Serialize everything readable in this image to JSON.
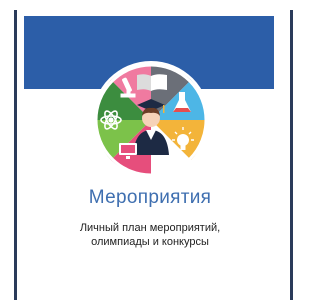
{
  "card": {
    "title": "Мероприятия",
    "subtitle_line1": "Личный план мероприятий,",
    "subtitle_line2": "олимпиады и конкурсы",
    "banner_color": "#2c5ea8",
    "title_color": "#3f6fb0",
    "border_color": "#2a3b5a",
    "emblem_icons": [
      "microscope-icon",
      "book-icon",
      "flask-icon",
      "atom-icon",
      "graduate-icon",
      "monitor-icon",
      "lightbulb-icon"
    ]
  }
}
